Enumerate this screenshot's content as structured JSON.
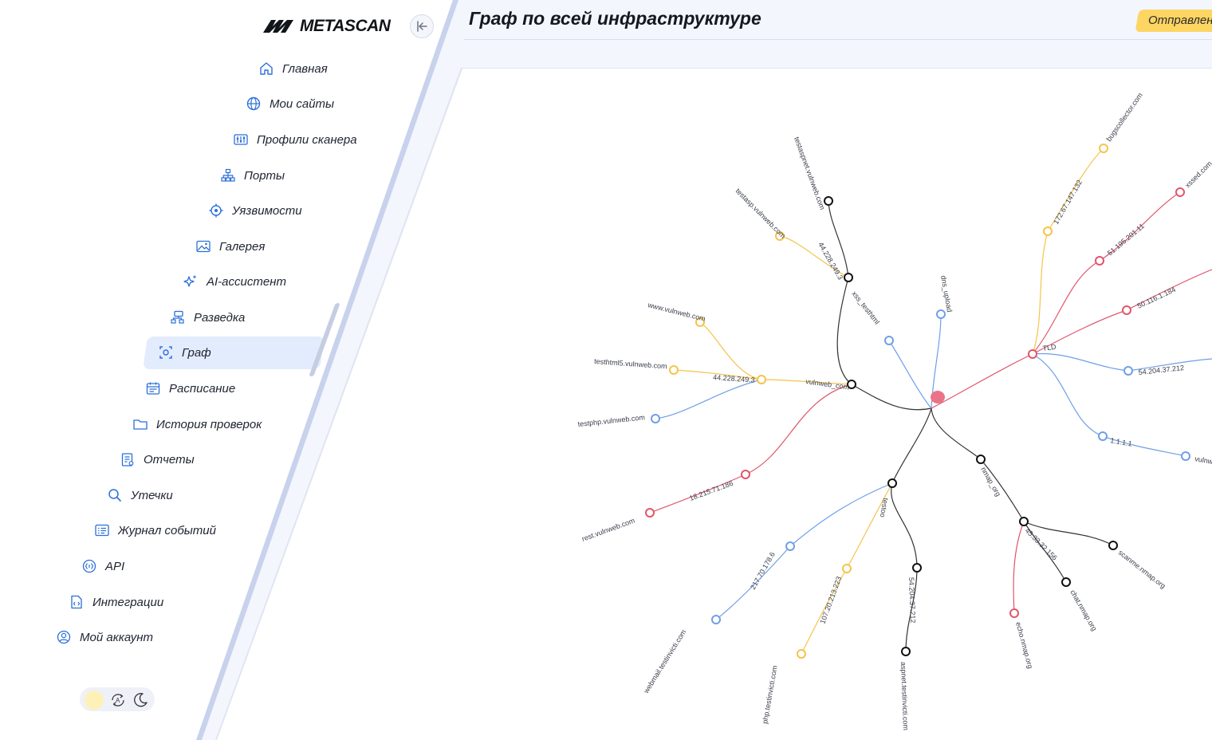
{
  "app": {
    "logo_text": "METASCAN"
  },
  "header": {
    "title": "Граф по всей инфраструктуре",
    "send_label": "Отправлен"
  },
  "colors": {
    "accent": "#2b6fd9",
    "active_bg": "#e3ecfc",
    "send_button": "#fdd562",
    "node_black": "#111111",
    "node_blue": "#6f9fe6",
    "node_yellow": "#f5c34a",
    "node_red": "#e0566b",
    "root_node": "#e9748a"
  },
  "sidebar": {
    "items": [
      {
        "label": "Главная",
        "icon": "home-icon"
      },
      {
        "label": "Мои сайты",
        "icon": "globe-icon"
      },
      {
        "label": "Профили сканера",
        "icon": "sliders-icon"
      },
      {
        "label": "Порты",
        "icon": "network-icon"
      },
      {
        "label": "Уязвимости",
        "icon": "target-icon"
      },
      {
        "label": "Галерея",
        "icon": "image-icon"
      },
      {
        "label": "AI-ассистент",
        "icon": "sparkle-icon"
      },
      {
        "label": "Разведка",
        "icon": "hierarchy-icon"
      },
      {
        "label": "Граф",
        "icon": "graph-icon",
        "active": true
      },
      {
        "label": "Расписание",
        "icon": "calendar-icon"
      },
      {
        "label": "История проверок",
        "icon": "folder-icon"
      },
      {
        "label": "Отчеты",
        "icon": "report-icon"
      },
      {
        "label": "Утечки",
        "icon": "search-icon"
      },
      {
        "label": "Журнал событий",
        "icon": "list-icon"
      },
      {
        "label": "API",
        "icon": "api-icon"
      },
      {
        "label": "Интеграции",
        "icon": "code-file-icon"
      },
      {
        "label": "Мой аккаунт",
        "icon": "user-icon"
      }
    ]
  },
  "theme": {
    "options": [
      "light",
      "auto",
      "dark"
    ],
    "selected": "light"
  },
  "graph": {
    "labels": [
      "testasp.vulnweb.com",
      "testaspnet.vulnweb.com",
      "44.228.249.3",
      "testphp.vulnweb.com",
      "www.vulnweb.com",
      "testhtml5.vulnweb.com",
      "vulnweb_com",
      "18.215.71.186",
      "rest.vulnweb.com",
      "dns_upload",
      "xss_testhtml",
      "44.228.249.3",
      "TLD",
      "172.67.147.132",
      "bugscollector.com",
      "xssed.com",
      "51.195.201.11",
      "50.116.1.184",
      "54.204.37.212",
      "1.1.1.1",
      "vulnweb",
      "nmap_org",
      "45.33.32.156",
      "scanme.nmap.org",
      "chat.nmap.org",
      "echo.nmap.org",
      "testoo",
      "217.70.178.6",
      "webmail.testinvicti.com",
      "107.20.213.223",
      "php.testinvicti.com",
      "54.204.37.212",
      "aspnet.testinvicti.com"
    ]
  }
}
